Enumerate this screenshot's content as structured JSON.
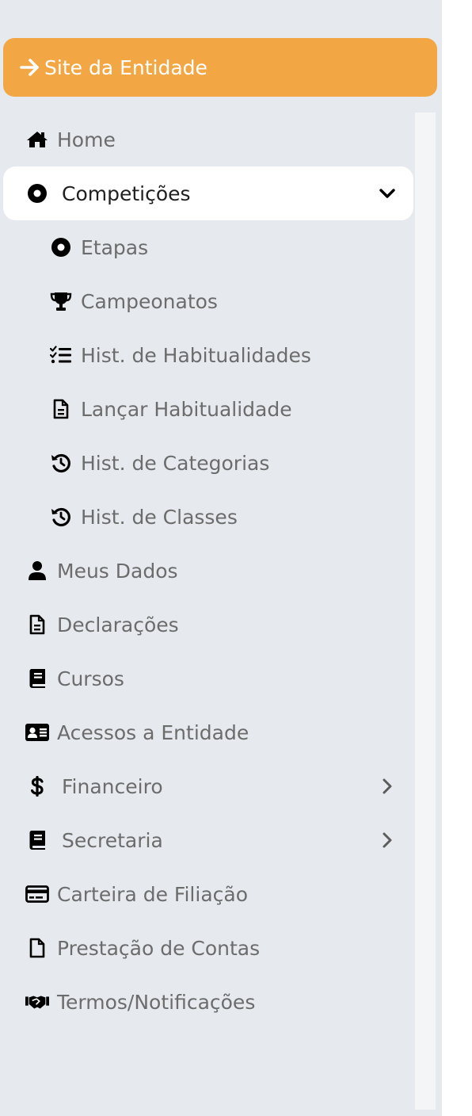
{
  "site_button": {
    "label": "Site da Entidade",
    "icon": "arrow-right-icon"
  },
  "menu": {
    "home": {
      "label": "Home",
      "icon": "home-icon"
    },
    "competicoes": {
      "label": "Competições",
      "icon": "circle-dot-icon",
      "expanded": true
    },
    "etapas": {
      "label": "Etapas",
      "icon": "circle-dot-icon"
    },
    "campeonatos": {
      "label": "Campeonatos",
      "icon": "trophy-icon"
    },
    "hist_habitualidades": {
      "label": "Hist. de Habitualidades",
      "icon": "list-check-icon"
    },
    "lancar_habitualidade": {
      "label": "Lançar Habitualidade",
      "icon": "file-lines-icon"
    },
    "hist_categorias": {
      "label": "Hist. de Categorias",
      "icon": "history-icon"
    },
    "hist_classes": {
      "label": "Hist. de Classes",
      "icon": "history-icon"
    },
    "meus_dados": {
      "label": "Meus Dados",
      "icon": "user-icon"
    },
    "declaracoes": {
      "label": "Declarações",
      "icon": "file-lines-icon"
    },
    "cursos": {
      "label": "Cursos",
      "icon": "book-icon"
    },
    "acessos": {
      "label": "Acessos a Entidade",
      "icon": "id-card-icon"
    },
    "financeiro": {
      "label": "Financeiro",
      "icon": "dollar-icon"
    },
    "secretaria": {
      "label": "Secretaria",
      "icon": "book-icon"
    },
    "carteira": {
      "label": "Carteira de Filiação",
      "icon": "credit-card-icon"
    },
    "prestacao": {
      "label": "Prestação de Contas",
      "icon": "file-icon"
    },
    "termos": {
      "label": "Termos/Notificações",
      "icon": "handshake-icon"
    }
  },
  "colors": {
    "sidebar_bg": "#e6e9ee",
    "accent": "#f3a744",
    "active_bg": "#ffffff",
    "text": "#6c6c6c"
  }
}
